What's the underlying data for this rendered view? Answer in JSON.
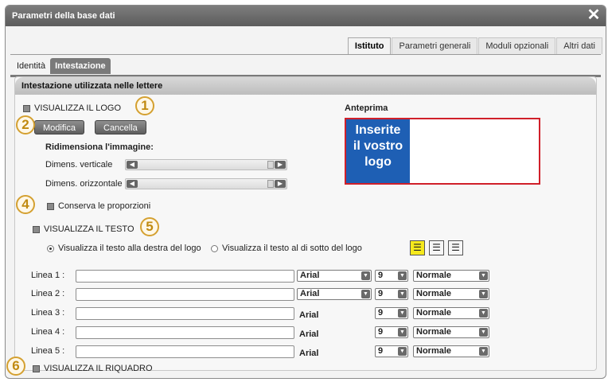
{
  "window": {
    "title": "Parametri della base dati"
  },
  "top_tabs": [
    {
      "label": "Istituto",
      "active": true
    },
    {
      "label": "Parametri generali",
      "active": false
    },
    {
      "label": "Moduli opzionali",
      "active": false
    },
    {
      "label": "Altri dati",
      "active": false
    }
  ],
  "sub_tabs": [
    {
      "label": "Identità",
      "active": false
    },
    {
      "label": "Intestazione",
      "active": true
    }
  ],
  "section": {
    "title": "Intestazione utilizzata nelle lettere"
  },
  "logo": {
    "show_label": "VISUALIZZA IL LOGO",
    "modify_label": "Modifica",
    "cancel_label": "Cancella",
    "resize_title": "Ridimensiona l'immagine:",
    "vertical_label": "Dimens. verticale",
    "horizontal_label": "Dimens. orizzontale",
    "keep_ratio_label": "Conserva le proporzioni"
  },
  "preview": {
    "title": "Anteprima",
    "logo_lines": [
      "Inserite",
      "il vostro",
      "logo"
    ]
  },
  "text": {
    "show_label": "VISUALIZZA IL TESTO",
    "radio_right": "Visualizza il testo alla destra del logo",
    "radio_below": "Visualizza il testo al di sotto del logo",
    "selected_radio": "right",
    "align_active": "left"
  },
  "lines": [
    {
      "label": "Linea 1 :",
      "value": "",
      "font": "Arial",
      "size": "9",
      "style": "Normale",
      "font_dropdown": true
    },
    {
      "label": "Linea 2 :",
      "value": "",
      "font": "Arial",
      "size": "9",
      "style": "Normale",
      "font_dropdown": true
    },
    {
      "label": "Linea 3 :",
      "value": "",
      "font": "Arial",
      "size": "9",
      "style": "Normale",
      "font_dropdown": false
    },
    {
      "label": "Linea 4 :",
      "value": "",
      "font": "Arial",
      "size": "9",
      "style": "Normale",
      "font_dropdown": false
    },
    {
      "label": "Linea 5 :",
      "value": "",
      "font": "Arial",
      "size": "9",
      "style": "Normale",
      "font_dropdown": false
    }
  ],
  "frame": {
    "show_label": "VISUALIZZA IL RIQUADRO"
  },
  "callouts": [
    "1",
    "2",
    "4",
    "5",
    "6"
  ],
  "colors": {
    "title_bar": "#6a6a6a",
    "logo_bg": "#1e5fb4",
    "preview_border": "#d0202a",
    "callout": "#d4a030",
    "align_active": "#f5e91c"
  }
}
